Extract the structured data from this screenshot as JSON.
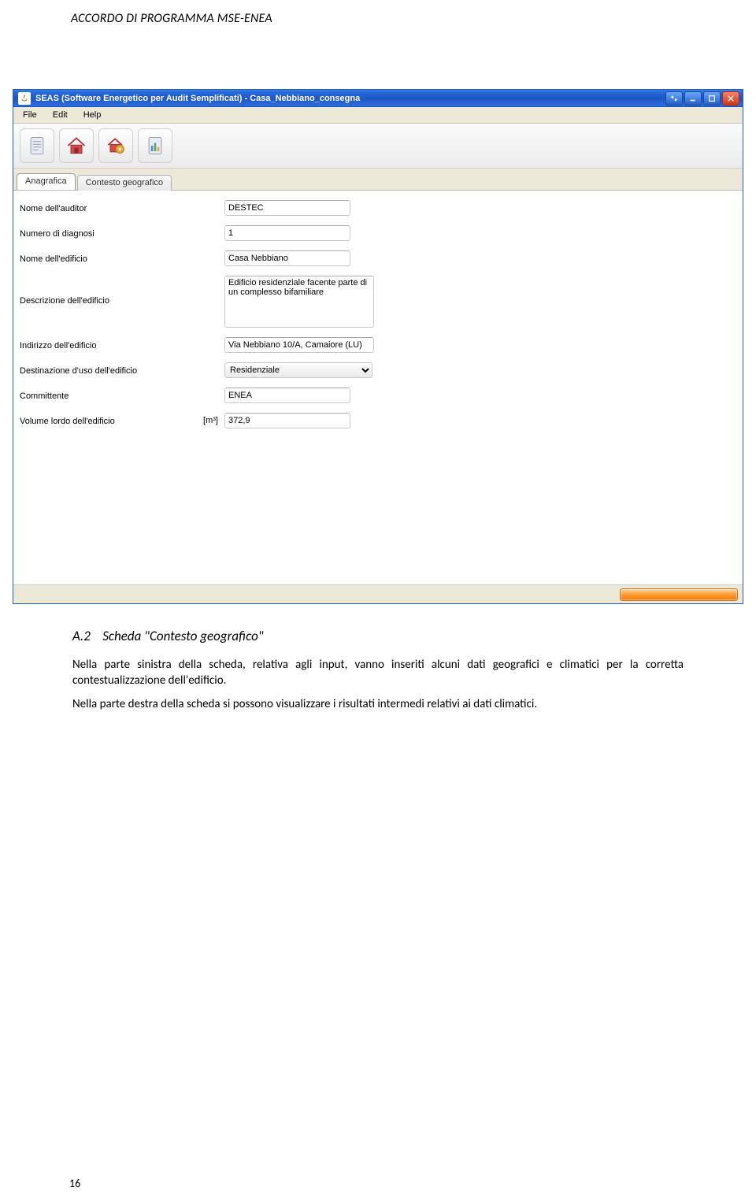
{
  "doc_header": "ACCORDO DI PROGRAMMA MSE-ENEA",
  "window": {
    "title": "SEAS (Software Energetico per Audit Semplificati) - Casa_Nebbiano_consegna"
  },
  "menubar": {
    "file": "File",
    "edit": "Edit",
    "help": "Help"
  },
  "tabs": {
    "anagrafica": "Anagrafica",
    "contesto": "Contesto geografico"
  },
  "form": {
    "labels": {
      "auditor": "Nome dell'auditor",
      "ndiag": "Numero di diagnosi",
      "edificio": "Nome dell'edificio",
      "descr": "Descrizione dell'edificio",
      "indirizzo": "Indirizzo dell'edificio",
      "destin": "Destinazione d'uso dell'edificio",
      "committ": "Committente",
      "volume": "Volume lordo dell'edificio",
      "volume_unit": "[m³]"
    },
    "values": {
      "auditor": "DESTEC",
      "ndiag": "1",
      "edificio": "Casa Nebbiano",
      "descr": "Edificio residenziale facente parte di un complesso bifamiliare",
      "indirizzo": "Via Nebbiano 10/A, Camaiore (LU)",
      "destin": "Residenziale",
      "committ": "ENEA",
      "volume": "372,9"
    }
  },
  "section": {
    "num": "A.2",
    "title": "Scheda \"Contesto geografico\"",
    "p1": "Nella parte sinistra della scheda, relativa agli input, vanno inseriti alcuni dati geografici e climatici per la corretta contestualizzazione dell'edificio.",
    "p2": "Nella parte destra della scheda si possono visualizzare i risultati intermedi relativi ai dati climatici."
  },
  "page_number": "16"
}
